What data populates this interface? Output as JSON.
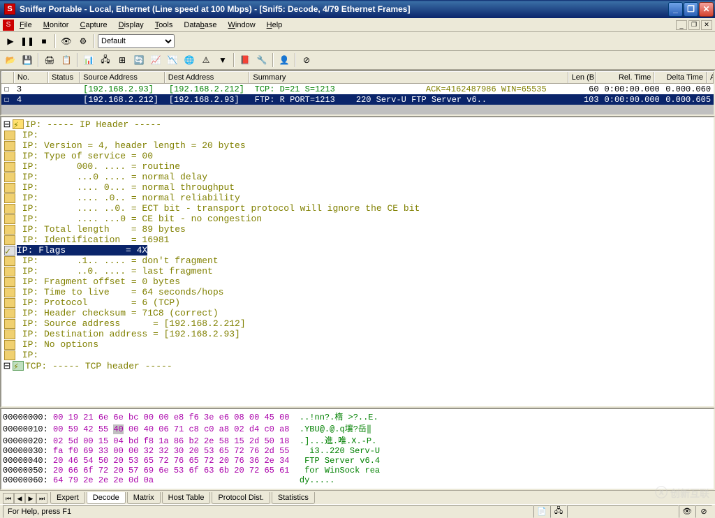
{
  "title": "Sniffer Portable - Local, Ethernet (Line speed at 100 Mbps) - [Snif5: Decode, 4/79 Ethernet Frames]",
  "menus": [
    "File",
    "Monitor",
    "Capture",
    "Display",
    "Tools",
    "Database",
    "Window",
    "Help"
  ],
  "toolbar_select": "Default",
  "grid_headers": [
    "",
    "No.",
    "Status",
    "Source Address",
    "Dest Address",
    "Summary",
    "Len (B",
    "Rel. Time",
    "Delta Time",
    "Abs. Time"
  ],
  "frames": [
    {
      "no": "3",
      "status": "",
      "src": "[192.168.2.93]",
      "dst": "[192.168.2.212]",
      "summary_tcp": "TCP: D=21 S=1213",
      "summary_ack": "ACK=4162487986 WIN=65535",
      "len": "60",
      "rel": "0:00:00.000",
      "delta": "0.000.060"
    },
    {
      "no": "4",
      "status": "",
      "src": "[192.168.2.212]",
      "dst": "[192.168.2.93]",
      "summary_ftp": "FTP: R PORT=1213",
      "summary_resp": "220 Serv-U FTP Server v6..",
      "len": "103",
      "rel": "0:00:00.000",
      "delta": "0.000.605"
    }
  ],
  "decode": {
    "ip_header": "IP: ----- IP Header -----",
    "lines": [
      "IP:",
      "IP: Version = 4, header length = 20 bytes",
      "IP: Type of service = 00",
      "IP:       000. .... = routine",
      "IP:       ...0 .... = normal delay",
      "IP:       .... 0... = normal throughput",
      "IP:       .... .0.. = normal reliability",
      "IP:       .... ..0. = ECT bit - transport protocol will ignore the CE bit",
      "IP:       .... ...0 = CE bit - no congestion",
      "IP: Total length    = 89 bytes",
      "IP: Identification  = 16981"
    ],
    "selected": "IP: Flags           = 4X",
    "lines2": [
      "IP:       .1.. .... = don't fragment",
      "IP:       ..0. .... = last fragment",
      "IP: Fragment offset = 0 bytes",
      "IP: Time to live    = 64 seconds/hops",
      "IP: Protocol        = 6 (TCP)",
      "IP: Header checksum = 71C8 (correct)",
      "IP: Source address      = [192.168.2.212]",
      "IP: Destination address = [192.168.2.93]",
      "IP: No options",
      "IP:"
    ],
    "tcp_header": "TCP: ----- TCP header -----"
  },
  "hex": [
    {
      "off": "00000000:",
      "bytes": "00 19 21 6e 6e bc 00 00 e8 f6 3e e6 08 00 45 00",
      "ascii": "..!nn?.楕 >?..E."
    },
    {
      "off": "00000010:",
      "bytes": "00 59 42 55 ",
      "hl": "40",
      "bytes2": " 00 40 06 71 c8 c0 a8 02 d4 c0 a8",
      "ascii": ".YBU@.@.q壤?岳‖"
    },
    {
      "off": "00000020:",
      "bytes": "02 5d 00 15 04 bd f8 1a 86 b2 2e 58 15 2d 50 18",
      "ascii": ".]...進.唯.X.-P."
    },
    {
      "off": "00000030:",
      "bytes": "fa f0 69 33 00 00 32 32 30 20 53 65 72 76 2d 55",
      "ascii": "  i3..220 Serv-U"
    },
    {
      "off": "00000040:",
      "bytes": "20 46 54 50 20 53 65 72 76 65 72 20 76 36 2e 34",
      "ascii": " FTP Server v6.4"
    },
    {
      "off": "00000050:",
      "bytes": "20 66 6f 72 20 57 69 6e 53 6f 63 6b 20 72 65 61",
      "ascii": " for WinSock rea"
    },
    {
      "off": "00000060:",
      "bytes": "64 79 2e 2e 2e 0d 0a",
      "ascii": "                           dy....."
    }
  ],
  "tabs": [
    "Expert",
    "Decode",
    "Matrix",
    "Host Table",
    "Protocol Dist.",
    "Statistics"
  ],
  "active_tab": "Decode",
  "status_text": "For Help, press F1",
  "watermark": "创新互联"
}
